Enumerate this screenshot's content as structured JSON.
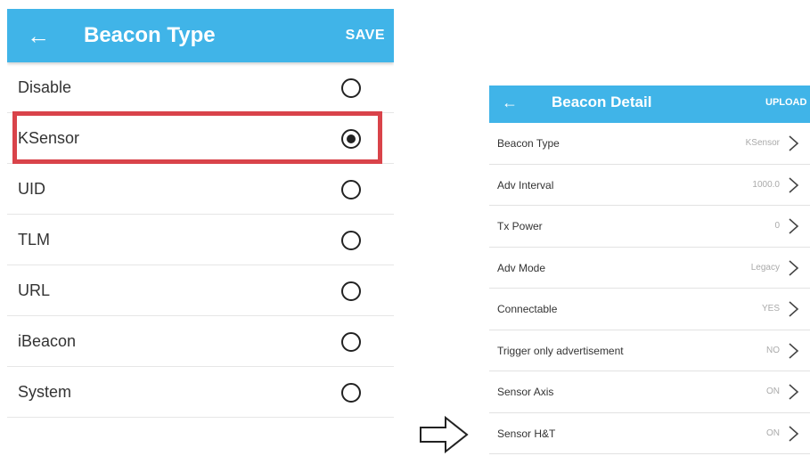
{
  "beacon_type_screen": {
    "back_icon": "arrow-left-icon",
    "title": "Beacon Type",
    "save_label": "SAVE",
    "options": [
      {
        "label": "Disable",
        "selected": false
      },
      {
        "label": "KSensor",
        "selected": true
      },
      {
        "label": "UID",
        "selected": false
      },
      {
        "label": "TLM",
        "selected": false
      },
      {
        "label": "URL",
        "selected": false
      },
      {
        "label": "iBeacon",
        "selected": false
      },
      {
        "label": "System",
        "selected": false
      }
    ],
    "highlight_color": "#d9434a"
  },
  "arrow_icon": "arrow-right-outline-icon",
  "beacon_detail_screen": {
    "back_icon": "arrow-left-icon",
    "title": "Beacon Detail",
    "upload_label": "UPLOAD",
    "rows": [
      {
        "label": "Beacon Type",
        "value": "KSensor"
      },
      {
        "label": "Adv Interval",
        "value": "1000.0"
      },
      {
        "label": "Tx Power",
        "value": "0"
      },
      {
        "label": "Adv Mode",
        "value": "Legacy"
      },
      {
        "label": "Connectable",
        "value": "YES"
      },
      {
        "label": "Trigger only advertisement",
        "value": "NO"
      },
      {
        "label": "Sensor Axis",
        "value": "ON"
      },
      {
        "label": "Sensor H&T",
        "value": "ON"
      }
    ]
  },
  "colors": {
    "header": "#40b4e8",
    "highlight": "#d9434a"
  }
}
